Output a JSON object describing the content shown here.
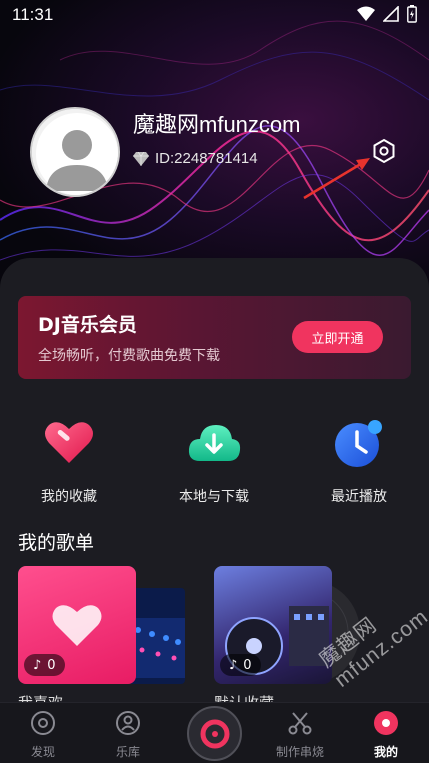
{
  "status": {
    "time": "11:31"
  },
  "profile": {
    "name": "魔趣网mfunzcom",
    "id_text": "ID:2248781414"
  },
  "vip": {
    "title": "DJ音乐会员",
    "subtitle": "全场畅听，付费歌曲免费下载",
    "button": "立即开通"
  },
  "quick_actions": [
    {
      "label": "我的收藏",
      "icon": "heart-icon"
    },
    {
      "label": "本地与下载",
      "icon": "cloud-download-icon"
    },
    {
      "label": "最近播放",
      "icon": "clock-icon"
    }
  ],
  "playlists_section": {
    "title": "我的歌单",
    "items": [
      {
        "name": "我喜欢",
        "count": "0"
      },
      {
        "name": "默认收藏",
        "count": "0"
      }
    ]
  },
  "watermark": "魔趣网 mfunz.com",
  "nav": {
    "items": [
      {
        "label": "发现"
      },
      {
        "label": "乐库"
      },
      {
        "label": "制作串烧"
      },
      {
        "label": "我的"
      }
    ]
  },
  "colors": {
    "accent": "#f0345f",
    "background": "#1c1c22",
    "vip_gradient_start": "#7c1730"
  }
}
